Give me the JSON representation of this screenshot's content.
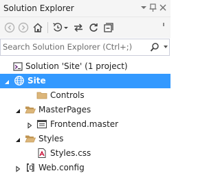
{
  "window": {
    "title": "Solution Explorer"
  },
  "toolbar": {
    "buttons": [
      "back-icon",
      "forward-icon",
      "home-icon",
      "history-icon",
      "sync-icon",
      "refresh-icon",
      "collapse-all-icon"
    ]
  },
  "search": {
    "placeholder": "Search Solution Explorer (Ctrl+;)"
  },
  "tree": {
    "solution": "Solution 'Site' (1 project)",
    "items": [
      {
        "label": "Site",
        "icon": "globe-icon",
        "level": 1,
        "expander": "expanded",
        "selected": true
      },
      {
        "label": "Controls",
        "icon": "folder-icon",
        "level": 2,
        "expander": "none",
        "selected": false
      },
      {
        "label": "MasterPages",
        "icon": "folder-open-icon",
        "level": 2,
        "expander": "expanded",
        "selected": false
      },
      {
        "label": "Frontend.master",
        "icon": "master-page-icon",
        "level": 3,
        "expander": "collapsed",
        "selected": false
      },
      {
        "label": "Styles",
        "icon": "folder-open-icon",
        "level": 2,
        "expander": "expanded",
        "selected": false
      },
      {
        "label": "Styles.css",
        "icon": "css-file-icon",
        "level": 3,
        "expander": "none",
        "selected": false
      },
      {
        "label": "Web.config",
        "icon": "config-file-icon",
        "level": 1,
        "expander": "collapsed",
        "selected": false
      }
    ]
  },
  "colors": {
    "selection": "#3399ff",
    "folder": "#dcb67a",
    "globe": "#ffffff"
  }
}
